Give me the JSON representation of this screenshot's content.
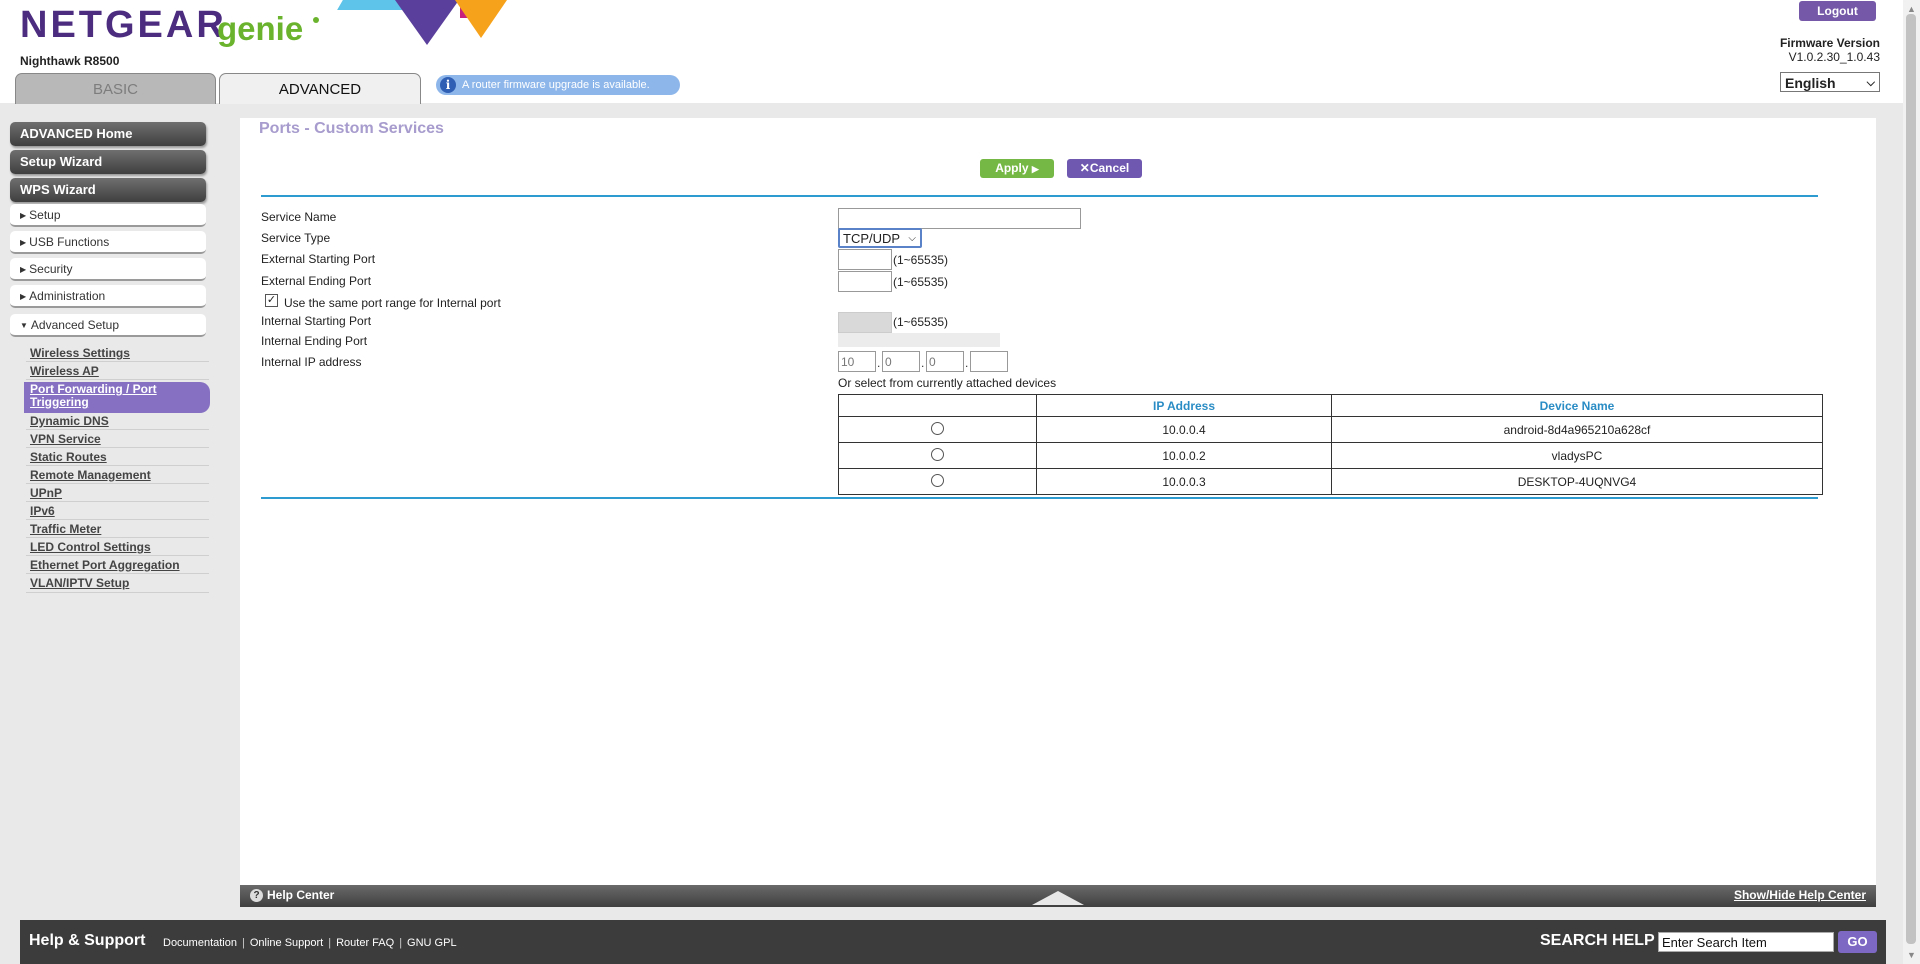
{
  "header": {
    "brand": "NETGEAR",
    "brand_suffix": "genie",
    "model": "Nighthawk R8500",
    "tabs": [
      {
        "label": "BASIC"
      },
      {
        "label": "ADVANCED"
      }
    ],
    "firmware_notice": "A router firmware upgrade is available.",
    "logout_label": "Logout",
    "firmware_label": "Firmware Version",
    "firmware_version": "V1.0.2.30_1.0.43",
    "language": "English"
  },
  "sidebar": {
    "main_buttons": [
      {
        "label": "ADVANCED Home"
      },
      {
        "label": "Setup Wizard"
      },
      {
        "label": "WPS Wizard"
      }
    ],
    "sections": [
      {
        "label": "Setup"
      },
      {
        "label": "USB Functions"
      },
      {
        "label": "Security"
      },
      {
        "label": "Administration"
      },
      {
        "label": "Advanced Setup"
      }
    ],
    "sub_items": [
      {
        "label": "Wireless Settings"
      },
      {
        "label": "Wireless AP"
      },
      {
        "label": "Port Forwarding / Port Triggering"
      },
      {
        "label": "Dynamic DNS"
      },
      {
        "label": "VPN Service"
      },
      {
        "label": "Static Routes"
      },
      {
        "label": "Remote Management"
      },
      {
        "label": "UPnP"
      },
      {
        "label": "IPv6"
      },
      {
        "label": "Traffic Meter"
      },
      {
        "label": "LED Control Settings"
      },
      {
        "label": "Ethernet Port Aggregation"
      },
      {
        "label": "VLAN/IPTV Setup"
      }
    ]
  },
  "page": {
    "title": "Ports - Custom Services",
    "apply_label": "Apply",
    "cancel_label": "Cancel",
    "fields": {
      "service_name": {
        "label": "Service Name",
        "value": ""
      },
      "service_type": {
        "label": "Service Type",
        "value": "TCP/UDP"
      },
      "ext_start": {
        "label": "External Starting Port",
        "range": "(1~65535)"
      },
      "ext_end": {
        "label": "External Ending Port",
        "range": "(1~65535)"
      },
      "same_range": {
        "label": "Use the same port range for Internal port",
        "checked": true
      },
      "int_start": {
        "label": "Internal Starting Port",
        "range": "(1~65535)"
      },
      "int_end": {
        "label": "Internal Ending Port"
      },
      "int_ip": {
        "label": "Internal IP address",
        "octets": [
          "10",
          "0",
          "0",
          ""
        ]
      }
    },
    "attached_caption": "Or select from currently attached devices",
    "table": {
      "headers": [
        "",
        "IP Address",
        "Device Name"
      ],
      "rows": [
        {
          "ip": "10.0.0.4",
          "name": "android-8d4a965210a628cf"
        },
        {
          "ip": "10.0.0.2",
          "name": "vladysPC"
        },
        {
          "ip": "10.0.0.3",
          "name": "DESKTOP-4UQNVG4"
        }
      ]
    }
  },
  "help_center": {
    "label": "Help Center",
    "toggle": "Show/Hide Help Center"
  },
  "footer": {
    "title": "Help & Support",
    "links": [
      "Documentation",
      "Online Support",
      "Router FAQ",
      "GNU GPL"
    ],
    "search_label": "SEARCH HELP",
    "search_placeholder": "Enter Search Item",
    "go_label": "GO"
  },
  "colors": {
    "accent_purple": "#7559a8",
    "apply_green": "#76b845",
    "rule_blue": "#2d9ad0"
  }
}
